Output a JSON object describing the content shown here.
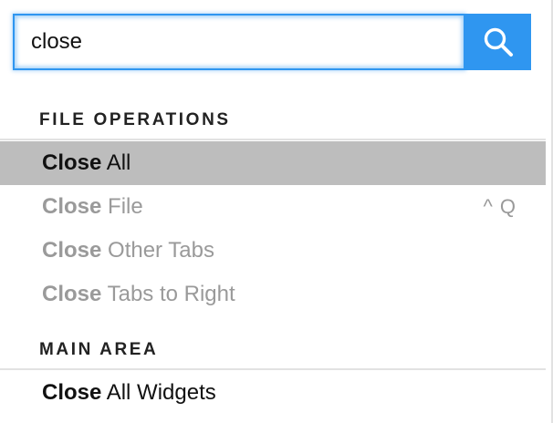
{
  "search": {
    "value": "close",
    "placeholder": ""
  },
  "icons": {
    "search_button": "search-icon"
  },
  "colors": {
    "accent": "#2f96f0",
    "selected_row": "#bdbdbd",
    "disabled_text": "#9a9a9a",
    "enabled_text": "#111111"
  },
  "sections": [
    {
      "title": "FILE OPERATIONS",
      "items": [
        {
          "match": "Close",
          "rest": " All",
          "shortcut": "",
          "state": "selected"
        },
        {
          "match": "Close",
          "rest": " File",
          "shortcut": "^ Q",
          "state": "disabled"
        },
        {
          "match": "Close",
          "rest": " Other Tabs",
          "shortcut": "",
          "state": "disabled"
        },
        {
          "match": "Close",
          "rest": " Tabs to Right",
          "shortcut": "",
          "state": "disabled"
        }
      ]
    },
    {
      "title": "MAIN AREA",
      "items": [
        {
          "match": "Close",
          "rest": " All Widgets",
          "shortcut": "",
          "state": "enabled"
        }
      ]
    }
  ]
}
